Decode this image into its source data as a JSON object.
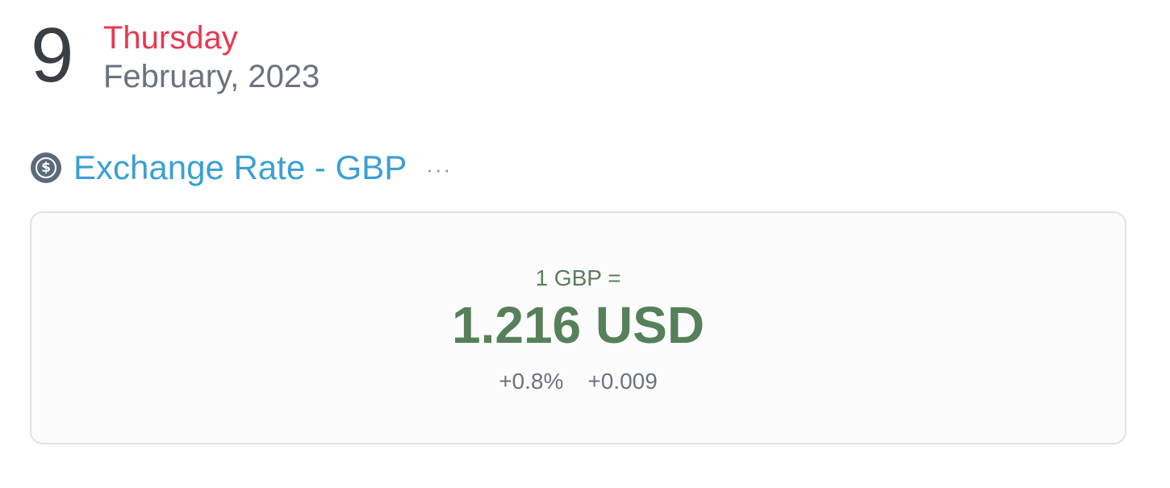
{
  "date": {
    "day": "9",
    "weekday": "Thursday",
    "month_year": "February, 2023"
  },
  "widget": {
    "icon": "dollar-circle-icon",
    "title": "Exchange Rate - GBP",
    "more_label": "···"
  },
  "rate": {
    "base": "1 GBP =",
    "value": "1.216 USD",
    "change_percent": "+0.8%",
    "change_absolute": "+0.009"
  },
  "colors": {
    "weekday": "#e8384f",
    "title": "#3b9fd4",
    "rate": "#56805a",
    "muted": "#6b7380"
  }
}
